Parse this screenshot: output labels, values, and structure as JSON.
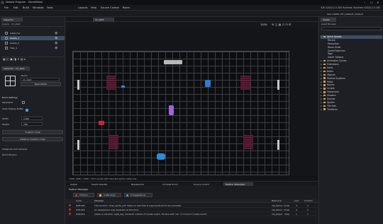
{
  "window": {
    "title": "Nebula Program - GameMaker",
    "controls": [
      "–",
      "☐",
      "✕"
    ]
  },
  "menu": {
    "items": [
      "File",
      "Edit",
      "Build",
      "Windows",
      "Tools",
      "Layouts",
      "Help",
      "Source Control",
      "Room"
    ],
    "right": "IDE v2024.2.0.163 Runtime: Runtime v2024.2.0.163"
  },
  "header_right": {
    "text": "Test | GMS2 VM | Default | Default"
  },
  "left": {
    "inspector_tab": "Inspector",
    "inspector_sub": "Layers - rm_start",
    "layers": [
      {
        "name": "Instances"
      },
      {
        "name": "Assets_1"
      },
      {
        "name": "Assets_2"
      },
      {
        "name": "Tiles_1"
      }
    ],
    "inspector2_tab": "Inspector - rm_start",
    "room_label": "Room",
    "room_name": "rm_start",
    "open_editor": "Open Editor",
    "room_settings": "Room Settings",
    "persistent": "Persistent",
    "clear_display": "Clear Display Buffer",
    "width_label": "Width",
    "width_value": "1366",
    "height_label": "Height",
    "height_value": "768",
    "creation_code": "Creation Code",
    "instance_order": "Instance Creation Order",
    "viewports": "Viewports and Cameras",
    "physics": "Room Physics"
  },
  "center": {
    "room_tab": "rm_start",
    "zoom": "100%",
    "status": "1366, 1985 | 1280 • Alt to paste with selected sprite instance/s"
  },
  "bottom_tabs": [
    "Output",
    "Search Results",
    "Breakpoints",
    "Compile Errors",
    "Source Control",
    "Feather Messages"
  ],
  "feather": {
    "title": "Feather Messages",
    "errors_label": "3 Errors",
    "warnings_label": "4 Warnings",
    "suggestions_label": "6 Suggestions",
    "columns": [
      "Code",
      "Message",
      "Resource",
      "Line",
      "Column"
    ],
    "rows": [
      {
        "code": "GM1028",
        "message": "The function 'draw_sprite_ext' takes no less than 9 arguments but 8 are provided.",
        "resource": "obj_items : Draw",
        "line": "4",
        "column": "1"
      },
      {
        "code": "GM1022",
        "message": "An assignment was expected at this time.",
        "resource": "obj_items : Draw",
        "line": "4",
        "column": "2"
      },
      {
        "code": "GM2016",
        "message": "Instance variable 'right_key' declared outside of Create event, declare with 'var' or move to Create event.",
        "resource": "obj_player : Step",
        "line": "1",
        "column": "1"
      }
    ]
  },
  "assets": {
    "tab": "Assets",
    "title": "Asset Browser",
    "tree": [
      {
        "label": "Quick Access",
        "depth": 0,
        "open": true
      },
      {
        "label": "Recent",
        "depth": 1
      },
      {
        "label": "Favourites",
        "depth": 1
      },
      {
        "label": "Room Order",
        "depth": 1
      },
      {
        "label": "Saved Searches",
        "depth": 1
      },
      {
        "label": "Tags",
        "depth": 1
      },
      {
        "label": "Game Options",
        "depth": 1
      },
      {
        "label": "Animation Curves",
        "depth": 0
      },
      {
        "label": "Extensions",
        "depth": 0
      },
      {
        "label": "Fonts",
        "depth": 0
      },
      {
        "label": "Notes",
        "depth": 0
      },
      {
        "label": "Objects",
        "depth": 0
      },
      {
        "label": "Particle Systems",
        "depth": 0
      },
      {
        "label": "Paths",
        "depth": 0
      },
      {
        "label": "Rooms",
        "depth": 0
      },
      {
        "label": "Scripts",
        "depth": 0
      },
      {
        "label": "Sequences",
        "depth": 0
      },
      {
        "label": "Shaders",
        "depth": 0
      },
      {
        "label": "Sounds",
        "depth": 0
      },
      {
        "label": "Sprites",
        "depth": 0
      },
      {
        "label": "Tile Sets",
        "depth": 0
      },
      {
        "label": "Timelines",
        "depth": 0
      }
    ]
  }
}
